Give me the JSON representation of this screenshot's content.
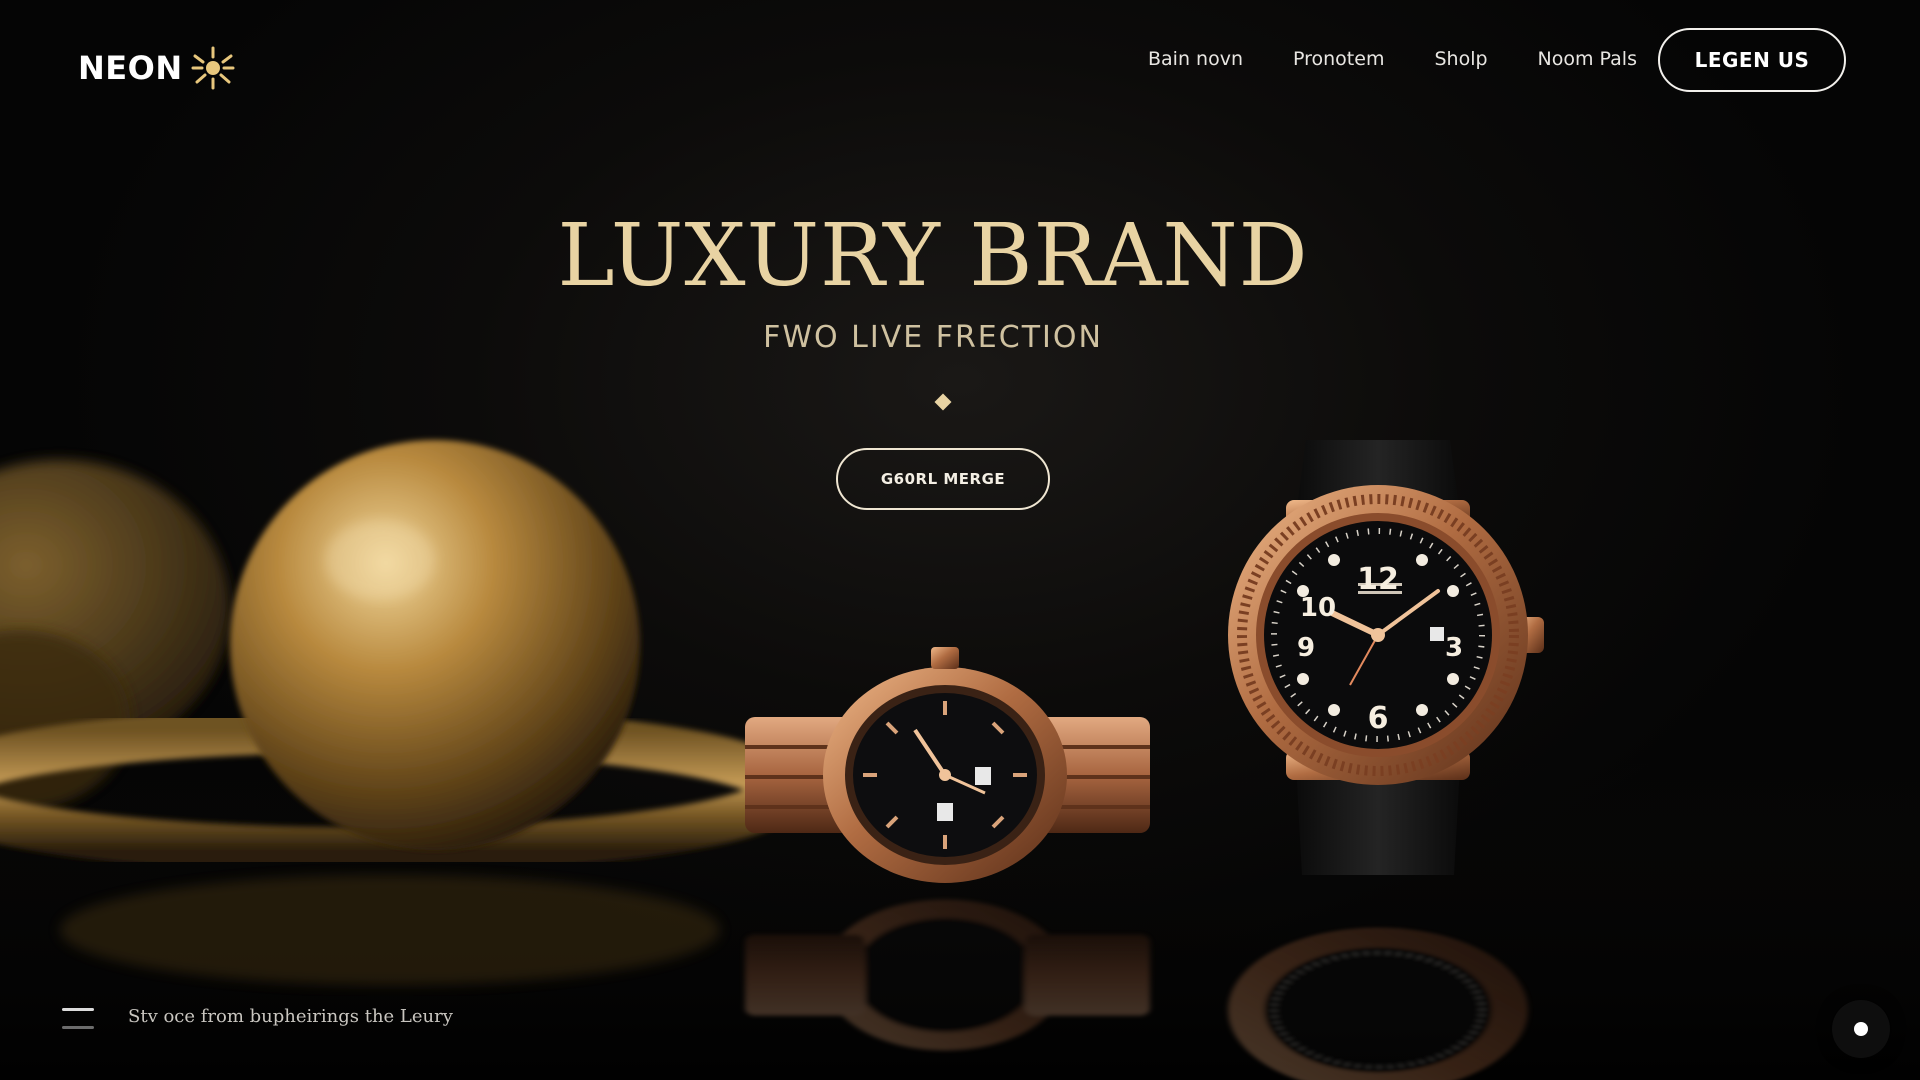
{
  "brand": {
    "name": "NEON",
    "icon": "sun-burst-icon"
  },
  "nav": {
    "items": [
      {
        "label": "Bain novn"
      },
      {
        "label": "Pronotem"
      },
      {
        "label": "Sholp"
      },
      {
        "label": "Noom Pals"
      }
    ],
    "cta_label": "LEGEN US"
  },
  "hero": {
    "title": "LUXURY BRAND",
    "subtitle": "FWO LIVE FRECTION",
    "cta_label": "G60RL MERGE",
    "divider_icon": "diamond-icon"
  },
  "watch_right": {
    "dial_numerals": [
      "12",
      "10",
      "9",
      "3",
      "6"
    ]
  },
  "footer": {
    "menu_icon": "hamburger-menu-icon",
    "tagline": "Stv oce from bupheirings the Leury",
    "chat_icon": "chat-dot-icon"
  },
  "colors": {
    "background": "#050505",
    "accent_gold": "#e8d3a3",
    "rose_gold": "#c98b5e",
    "text_white": "#ffffff"
  }
}
